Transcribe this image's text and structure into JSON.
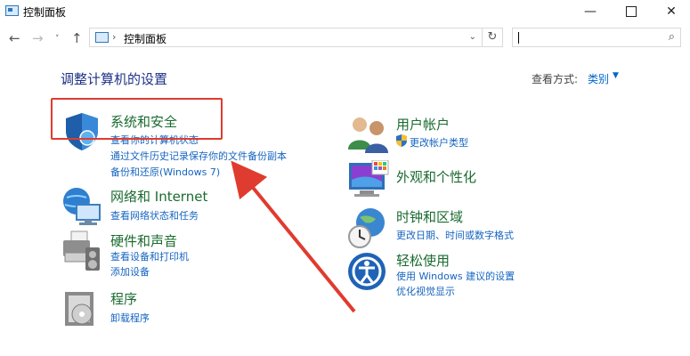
{
  "window": {
    "title": "控制面板",
    "minimize": "—",
    "close": "✕"
  },
  "nav": {
    "back": "←",
    "forward": "→",
    "dropdown": "˅",
    "up": "↑"
  },
  "address": {
    "separator": "›",
    "crumb": "控制面板",
    "dropdown": "⌄",
    "refresh": "↻"
  },
  "search": {
    "placeholder": "",
    "icon": "⌕"
  },
  "main": {
    "heading": "调整计算机的设置",
    "view_by_label": "查看方式:",
    "view_by_value": "类别",
    "view_by_arrow": "▼"
  },
  "categories": [
    {
      "title": "系统和安全",
      "links": [
        "查看你的计算机状态",
        "通过文件历史记录保存你的文件备份副本",
        "备份和还原(Windows 7)"
      ],
      "icon": "shield-icon"
    },
    {
      "title": "网络和 Internet",
      "links": [
        "查看网络状态和任务"
      ],
      "icon": "network-icon"
    },
    {
      "title": "硬件和声音",
      "links": [
        "查看设备和打印机",
        "添加设备"
      ],
      "icon": "printer-icon"
    },
    {
      "title": "程序",
      "links": [
        "卸载程序"
      ],
      "icon": "programs-icon"
    },
    {
      "title": "用户帐户",
      "links": [
        "更改帐户类型"
      ],
      "icon": "users-icon"
    },
    {
      "title": "外观和个性化",
      "links": [],
      "icon": "monitor-icon"
    },
    {
      "title": "时钟和区域",
      "links": [
        "更改日期、时间或数字格式"
      ],
      "icon": "clock-globe-icon"
    },
    {
      "title": "轻松使用",
      "links": [
        "使用 Windows 建议的设置",
        "优化视觉显示"
      ],
      "icon": "ease-of-access-icon"
    }
  ],
  "annotation": {
    "color": "#e03b2f"
  }
}
